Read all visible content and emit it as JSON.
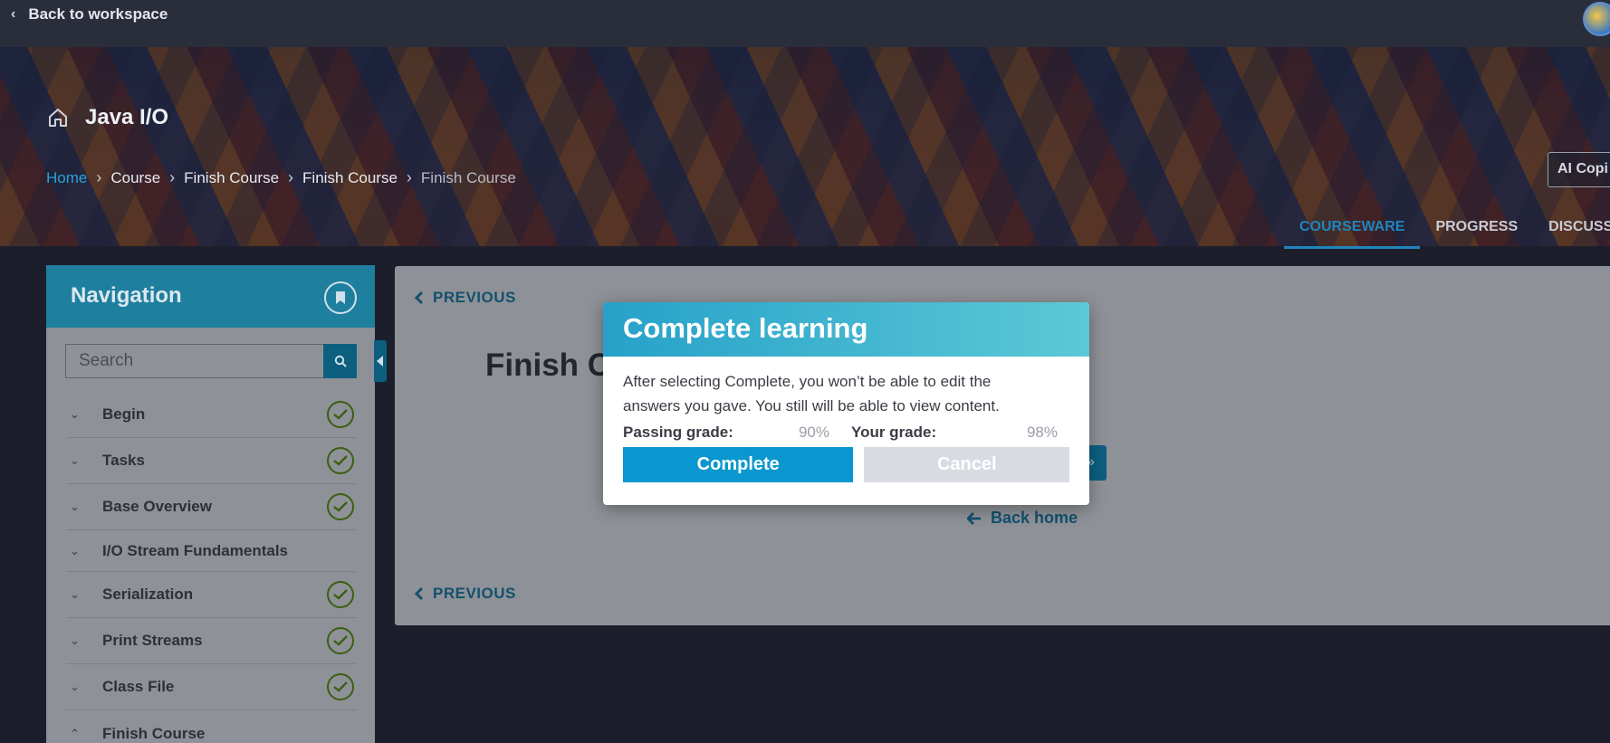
{
  "topbar": {
    "back_label": "Back to workspace"
  },
  "course": {
    "title": "Java I/O"
  },
  "breadcrumb": {
    "items": [
      "Home",
      "Course",
      "Finish Course",
      "Finish Course",
      "Finish Course"
    ]
  },
  "header_actions": {
    "ai_copilot_label": "AI Copi"
  },
  "tabs": [
    {
      "label": "COURSEWARE",
      "active": true
    },
    {
      "label": "PROGRESS",
      "active": false
    },
    {
      "label": "DISCUSSI",
      "active": false
    }
  ],
  "navigation": {
    "title": "Navigation",
    "search_placeholder": "Search",
    "items": [
      {
        "label": "Begin",
        "completed": true,
        "expanded": false
      },
      {
        "label": "Tasks",
        "completed": true,
        "expanded": false
      },
      {
        "label": "Base Overview",
        "completed": true,
        "expanded": false
      },
      {
        "label": "I/O Stream Fundamentals",
        "completed": false,
        "expanded": false
      },
      {
        "label": "Serialization",
        "completed": true,
        "expanded": false
      },
      {
        "label": "Print Streams",
        "completed": true,
        "expanded": false
      },
      {
        "label": "Class File",
        "completed": true,
        "expanded": false
      },
      {
        "label": "Finish Course",
        "completed": false,
        "expanded": true
      }
    ]
  },
  "content": {
    "previous_label": "PREVIOUS",
    "heading": "Finish Co",
    "next_fragment": "»",
    "back_home_label": "Back home"
  },
  "modal": {
    "title": "Complete learning",
    "message": "After selecting Complete, you won’t be able to edit the answers you gave. You still will be able to view content.",
    "passing_grade_label": "Passing grade:",
    "passing_grade_value": "90%",
    "your_grade_label": "Your grade:",
    "your_grade_value": "98%",
    "complete_label": "Complete",
    "cancel_label": "Cancel"
  },
  "colors": {
    "accent": "#0a97d0",
    "nav_header": "#1f7f9f",
    "check": "#3b5f12"
  }
}
